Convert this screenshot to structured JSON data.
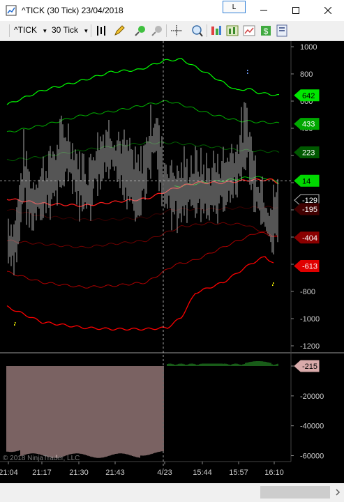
{
  "window": {
    "title": "^TICK (30 Tick)  23/04/2018",
    "link_button": "L"
  },
  "toolbar": {
    "instrument": "^TICK",
    "interval": "30 Tick",
    "icons": [
      "bar-type-icon",
      "pencil-draw-icon",
      "zoom-in-icon",
      "zoom-out-icon",
      "crosshair-icon",
      "magnifier-icon",
      "indicators-icon",
      "strategies-icon",
      "chart-style-icon",
      "money-icon",
      "properties-icon"
    ]
  },
  "chart": {
    "copyright": "© 2018 NinjaTrader, LLC",
    "x_labels": [
      "21:04",
      "21:17",
      "21:30",
      "21:43",
      "4/23",
      "15:44",
      "15:57",
      "16:10"
    ],
    "price_axis": [
      "1000",
      "800",
      "600",
      "400",
      "200",
      "0",
      "-200",
      "-400",
      "-600",
      "-800",
      "-1000",
      "-1200"
    ],
    "price_markers": [
      {
        "text": "642",
        "color": "#00e600"
      },
      {
        "text": "433",
        "color": "#00a800"
      },
      {
        "text": "223",
        "color": "#005800"
      },
      {
        "text": "14",
        "color": "#00d800"
      },
      {
        "text": "-129",
        "color": "#000000"
      },
      {
        "text": "-195",
        "color": "#400000"
      },
      {
        "text": "-404",
        "color": "#8a0000"
      },
      {
        "text": "-613",
        "color": "#e00000"
      }
    ],
    "volume_axis": [
      "0",
      "-20000",
      "-40000",
      "-60000"
    ],
    "volume_marker": "-215",
    "crosshair_price": 14,
    "colors": {
      "upper_bands": "#00ff00",
      "lower_bands": "#ff0000",
      "price_bars": "#aaaaaa",
      "volume": "#f3c4c4"
    }
  }
}
